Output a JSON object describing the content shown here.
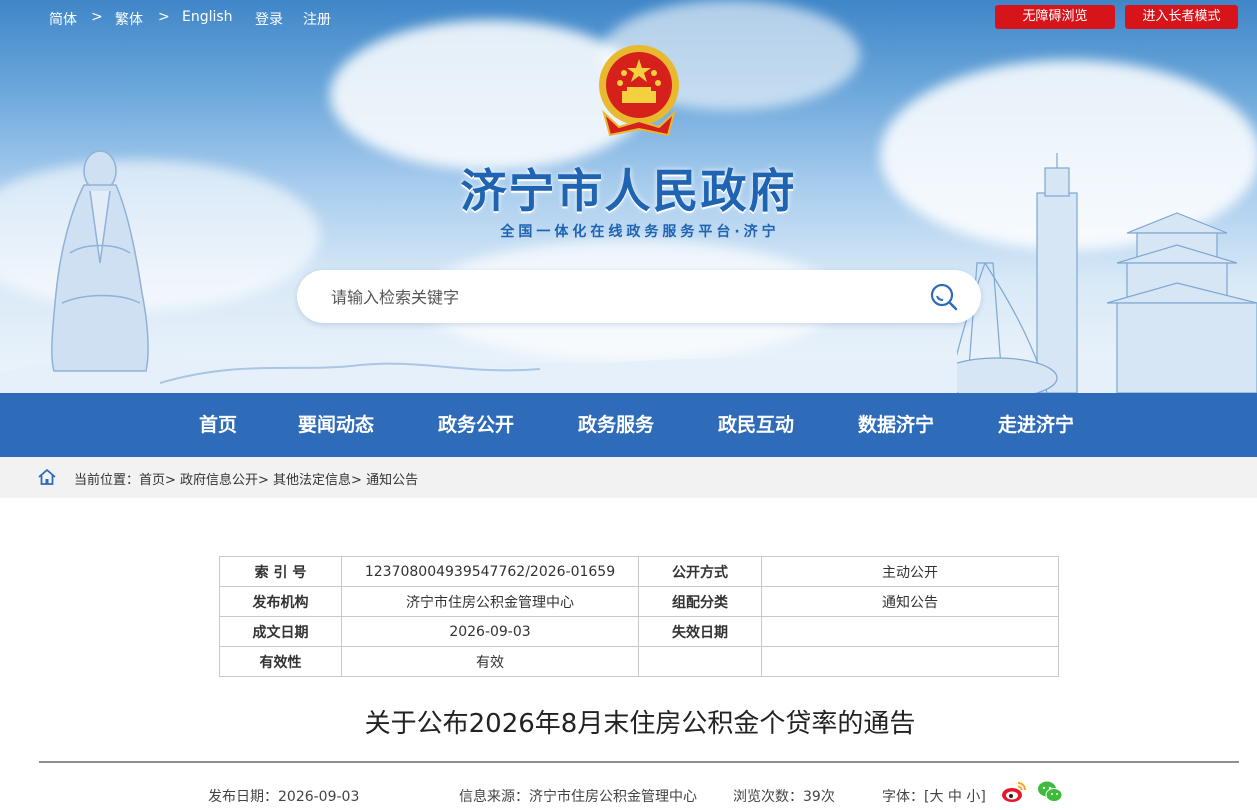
{
  "topbar": {
    "lang_simplified": "简体",
    "lang_traditional": "繁体",
    "lang_english": "English",
    "separator": ">",
    "login": "登录",
    "register": "注册",
    "accessible": "无障碍浏览",
    "elder_mode": "进入长者模式"
  },
  "header": {
    "title": "济宁市人民政府",
    "subtitle": "全国一体化在线政务服务平台·济宁",
    "search_placeholder": "请输入检索关键字"
  },
  "nav": {
    "items": [
      "首页",
      "要闻动态",
      "政务公开",
      "政务服务",
      "政民互动",
      "数据济宁",
      "走进济宁"
    ]
  },
  "breadcrumb": {
    "text": "当前位置：首页> 政府信息公开> 其他法定信息> 通知公告"
  },
  "info_table": {
    "rows": [
      {
        "k1": "索 引 号",
        "v1": "123708004939547762/2026-01659",
        "k2": "公开方式",
        "v2": "主动公开"
      },
      {
        "k1": "发布机构",
        "v1": "济宁市住房公积金管理中心",
        "k2": "组配分类",
        "v2": "通知公告"
      },
      {
        "k1": "成文日期",
        "v1": "2026-09-03",
        "k2": "失效日期",
        "v2": ""
      },
      {
        "k1": "有效性",
        "v1": "有效",
        "k2": "",
        "v2": ""
      }
    ]
  },
  "article": {
    "title": "关于公布2026年8月末住房公积金个贷率的通告",
    "publish_date": "发布日期：2026-09-03",
    "source": "信息来源：济宁市住房公积金管理中心",
    "views": "浏览次数：39次",
    "font_size": "字体：[大 中 小]"
  },
  "colors": {
    "brand_blue": "#2e6bb8",
    "title_blue": "#1f63b3",
    "button_red": "#d7141a"
  },
  "icons": [
    "search-icon",
    "home-icon",
    "weibo-icon",
    "wechat-icon",
    "national-emblem"
  ]
}
